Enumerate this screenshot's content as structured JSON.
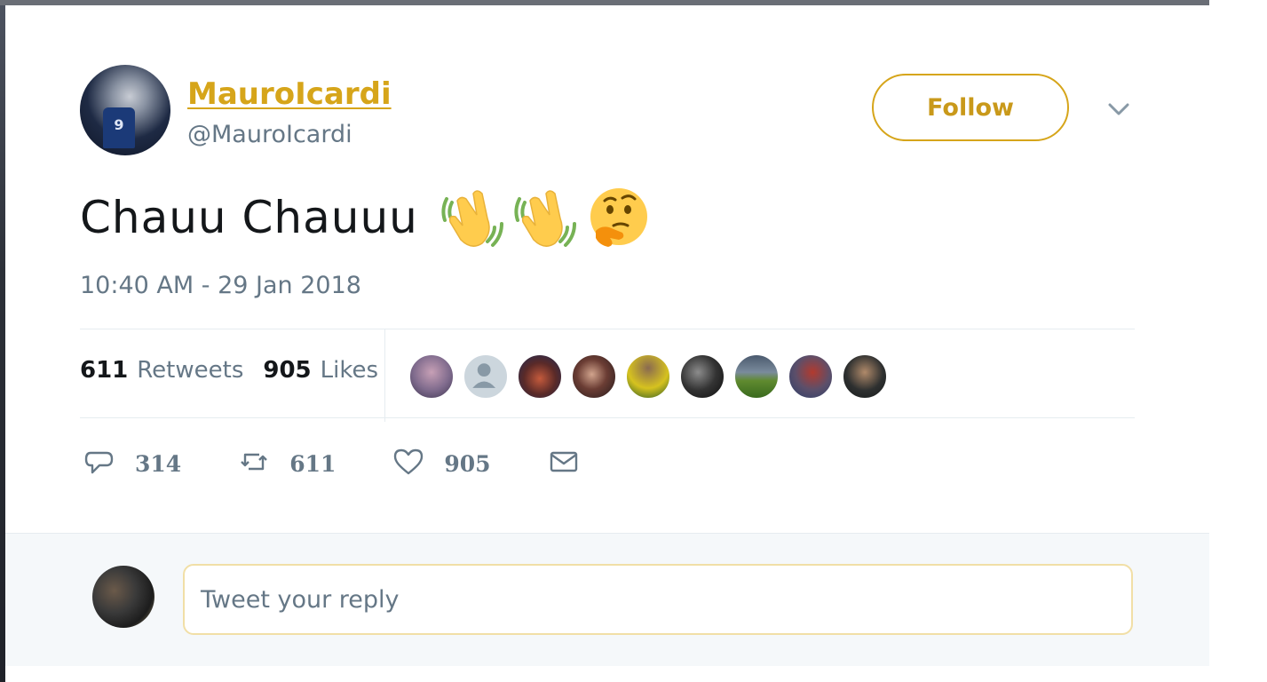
{
  "colors": {
    "accent": "#d6a51a",
    "muted_text": "#657786",
    "primary_text": "#14171a",
    "divider": "#e6ecf0",
    "reply_bg": "#f5f8fa"
  },
  "user": {
    "display_name": "MauroIcardi",
    "handle": "@MauroIcardi",
    "avatar_icon": "profile-photo-icon",
    "jersey_number": "9"
  },
  "header": {
    "follow_label": "Follow",
    "menu_icon": "chevron-down-icon"
  },
  "tweet": {
    "text": "Chauu Chauuu",
    "emojis": [
      "waving-hand-emoji",
      "waving-hand-emoji",
      "thinking-face-emoji"
    ],
    "timestamp": "10:40 AM - 29 Jan 2018"
  },
  "stats": {
    "retweets_count": "611",
    "retweets_label": "Retweets",
    "likes_count": "905",
    "likes_label": "Likes",
    "likers": [
      {
        "icon": "liker-avatar-1"
      },
      {
        "icon": "default-avatar-icon"
      },
      {
        "icon": "liker-avatar-3"
      },
      {
        "icon": "liker-avatar-4"
      },
      {
        "icon": "liker-avatar-5"
      },
      {
        "icon": "liker-avatar-6"
      },
      {
        "icon": "liker-avatar-7"
      },
      {
        "icon": "liker-avatar-8"
      },
      {
        "icon": "liker-avatar-9"
      }
    ]
  },
  "actions": {
    "reply_count": "314",
    "reply_icon": "reply-icon",
    "retweet_count": "611",
    "retweet_icon": "retweet-icon",
    "like_count": "905",
    "like_icon": "heart-icon",
    "dm_icon": "envelope-icon"
  },
  "reply": {
    "placeholder": "Tweet your reply",
    "avatar_icon": "my-avatar-icon"
  }
}
